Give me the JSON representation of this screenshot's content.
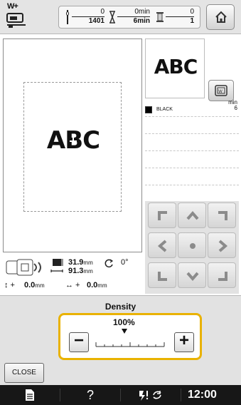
{
  "status_bar": {
    "presser_label": "W+",
    "stitch_current": "0",
    "stitch_total": "1401",
    "time_current": "0min",
    "time_total": "6min",
    "color_current": "0",
    "color_total": "1"
  },
  "design": {
    "text": "ABC",
    "thumbnail_text": "ABC"
  },
  "thread_colors": [
    {
      "name": "BLACK",
      "minutes": "6",
      "min_label": "min",
      "color": "#000000"
    }
  ],
  "info": {
    "width": "31.9",
    "height": "91.3",
    "unit": "mm",
    "rotation": "0°",
    "pos_y": "0.0",
    "pos_x": "0.0"
  },
  "density": {
    "title": "Density",
    "percent": "100%",
    "value_percent": 100,
    "minus_label": "−",
    "plus_label": "+"
  },
  "buttons": {
    "close": "CLOSE"
  },
  "nav": {
    "help": "?",
    "time": "12:00"
  },
  "colors": {
    "highlight": "#e9b200",
    "panel": "#e2e2e2",
    "navbar": "#171717"
  },
  "icons": [
    "presser-foot-icon",
    "needle-icon",
    "hourglass-icon",
    "spool-icon",
    "home-icon",
    "frame-view-icon",
    "arrow-up-left-icon",
    "arrow-up-icon",
    "arrow-up-right-icon",
    "arrow-left-icon",
    "center-icon",
    "arrow-right-icon",
    "arrow-down-left-icon",
    "arrow-down-icon",
    "arrow-down-right-icon",
    "document-icon",
    "help-icon",
    "wireless-icon",
    "rotate-icon"
  ]
}
